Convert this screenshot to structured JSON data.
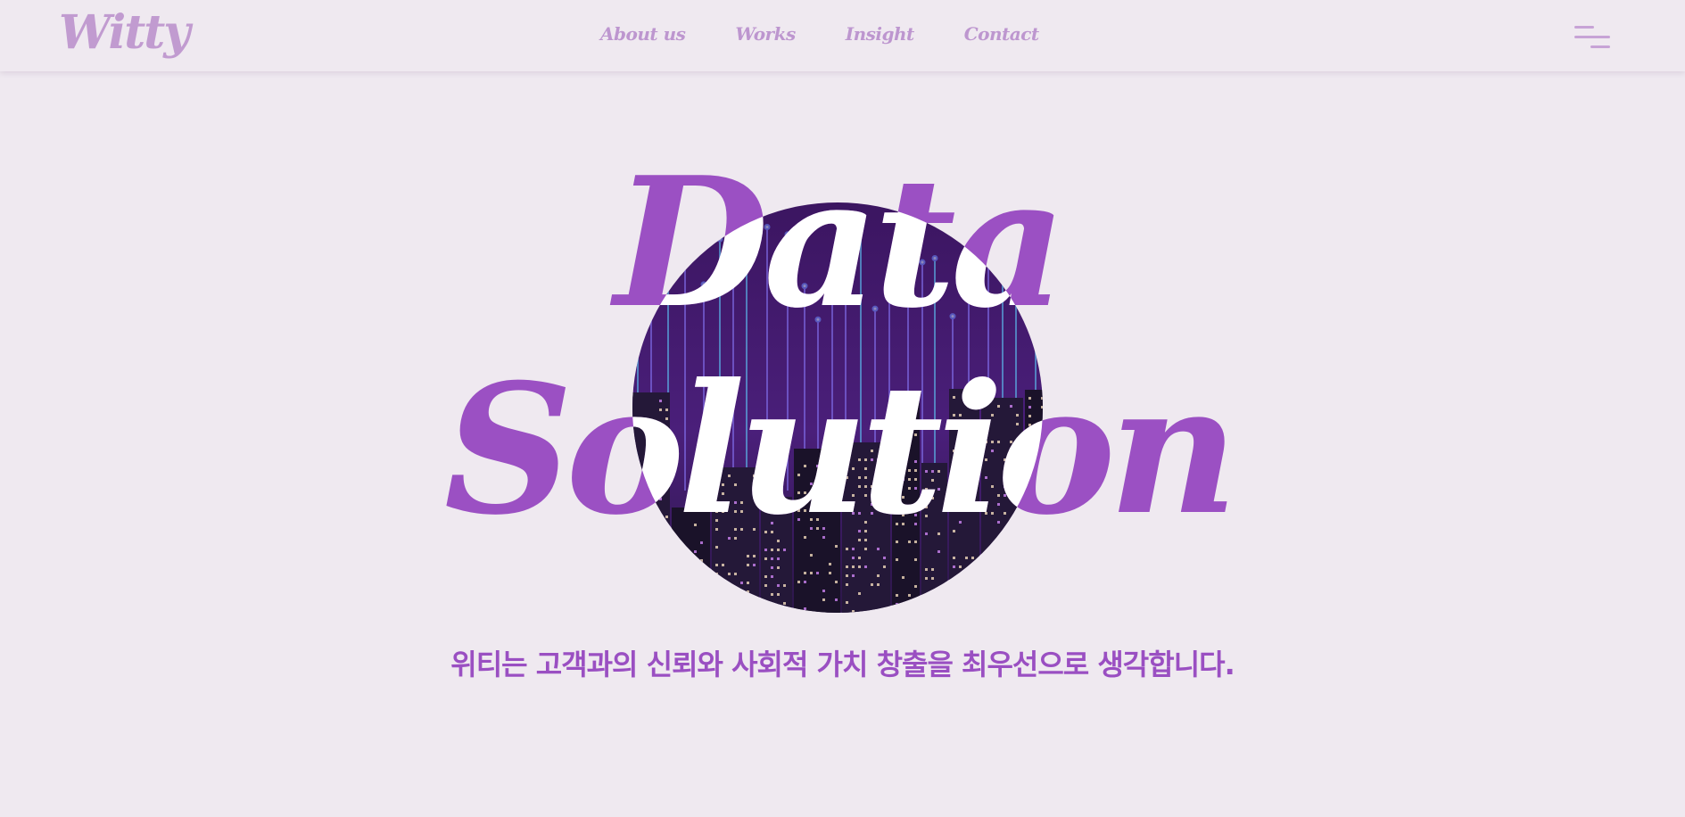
{
  "brand": {
    "logo": "Witty"
  },
  "nav": {
    "items": [
      {
        "label": "About us"
      },
      {
        "label": "Works"
      },
      {
        "label": "Insight"
      },
      {
        "label": "Contact"
      }
    ]
  },
  "hero": {
    "line1": "Data",
    "line2": "Solution",
    "tagline": "위티는 고객과의 신뢰와 사회적 가치 창출을 최우선으로 생각합니다."
  },
  "colors": {
    "background": "#efe9f0",
    "accent": "#9b50c3",
    "nav_text": "#bd96cf",
    "logo": "#c19bd0"
  },
  "icons": {
    "menu": "hamburger-menu-icon"
  }
}
